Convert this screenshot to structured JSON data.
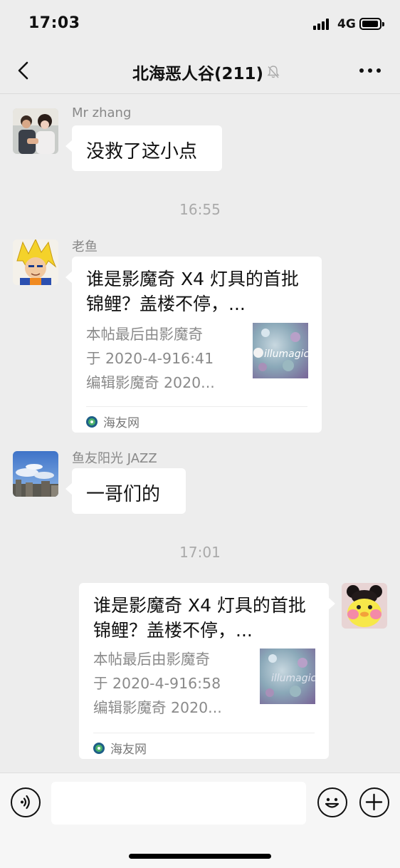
{
  "status_bar": {
    "time": "17:03",
    "network": "4G"
  },
  "nav": {
    "title": "北海恶人谷(211)"
  },
  "messages": [
    {
      "sender": "Mr zhang",
      "text": "没救了这小点"
    },
    {
      "time": "16:55"
    },
    {
      "sender": "老鱼",
      "card": {
        "title": "谁是影魔奇 X4 灯具的首批锦鲤？盖楼不停，...",
        "desc_lines": [
          "本帖最后由影魔奇",
          "于 2020-4-916:41",
          "编辑影魔奇 2020..."
        ],
        "thumb_text": "illumagic",
        "source": "海友网"
      }
    },
    {
      "sender": "鱼友阳光 JAZZ",
      "text": "一哥们的"
    },
    {
      "time": "17:01"
    },
    {
      "sender": "self",
      "card": {
        "title": "谁是影魔奇 X4 灯具的首批锦鲤？盖楼不停，...",
        "desc_lines": [
          "本帖最后由影魔奇",
          "于 2020-4-916:58",
          "编辑影魔奇 2020..."
        ],
        "thumb_text": "illumagic",
        "source": "海友网"
      }
    }
  ],
  "input": {
    "value": ""
  }
}
